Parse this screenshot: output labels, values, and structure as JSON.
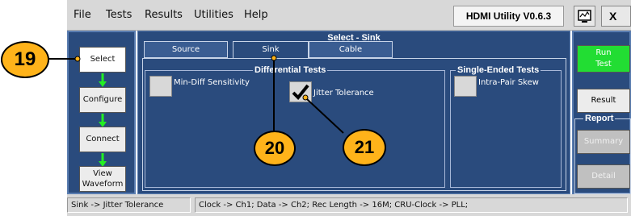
{
  "menubar": {
    "items": [
      "File",
      "Tests",
      "Results",
      "Utilities",
      "Help"
    ],
    "version": "HDMI Utility V0.6.3",
    "close_label": "X"
  },
  "sidebar": {
    "buttons": [
      {
        "label": "Select",
        "active": true
      },
      {
        "label": "Configure",
        "active": false
      },
      {
        "label": "Connect",
        "active": false
      },
      {
        "label": "View\nWaveform",
        "active": false
      }
    ]
  },
  "main": {
    "title": "Select - Sink",
    "tabs": [
      {
        "label": "Source"
      },
      {
        "label": "Sink",
        "active": true
      },
      {
        "label": "Cable"
      }
    ],
    "differential": {
      "title": "Differential Tests",
      "tests": [
        {
          "label": "Min-Diff Sensitivity",
          "checked": false
        },
        {
          "label": "Jitter Tolerance",
          "checked": true
        }
      ]
    },
    "single_ended": {
      "title": "Single-Ended Tests",
      "tests": [
        {
          "label": "Intra-Pair Skew",
          "checked": false
        }
      ]
    }
  },
  "right_panel": {
    "run_label": "Run\nTest",
    "result_label": "Result",
    "report_title": "Report",
    "summary_label": "Summary",
    "detail_label": "Detail"
  },
  "status": {
    "left": "Sink -> Jitter Tolerance",
    "right": "Clock -> Ch1;  Data -> Ch2;  Rec Length -> 16M;  CRU-Clock -> PLL;"
  },
  "callouts": [
    "19",
    "20",
    "21"
  ],
  "colors": {
    "panel_bg": "#2a4b7d",
    "callout_fill": "#ffb31a",
    "run_button": "#22dd33",
    "arrow": "#22ee22"
  },
  "icons": {
    "monitor": "monitor-icon",
    "checkmark": "checkmark-icon",
    "flow_arrow": "arrow-down-icon"
  }
}
